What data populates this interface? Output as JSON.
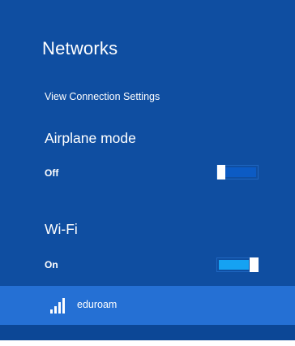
{
  "panel": {
    "title": "Networks",
    "view_settings_link": "View Connection Settings"
  },
  "airplane_mode": {
    "heading": "Airplane mode",
    "state": "Off",
    "enabled": false
  },
  "wifi": {
    "heading": "Wi-Fi",
    "state": "On",
    "enabled": true
  },
  "networks": [
    {
      "name": "eduroam",
      "icon": "wifi-signal-icon"
    }
  ],
  "colors": {
    "panel_background": "#0f4ea1",
    "selected_item": "#2570d4",
    "toggle_on_accent": "#15a2f2",
    "text": "#ffffff"
  }
}
